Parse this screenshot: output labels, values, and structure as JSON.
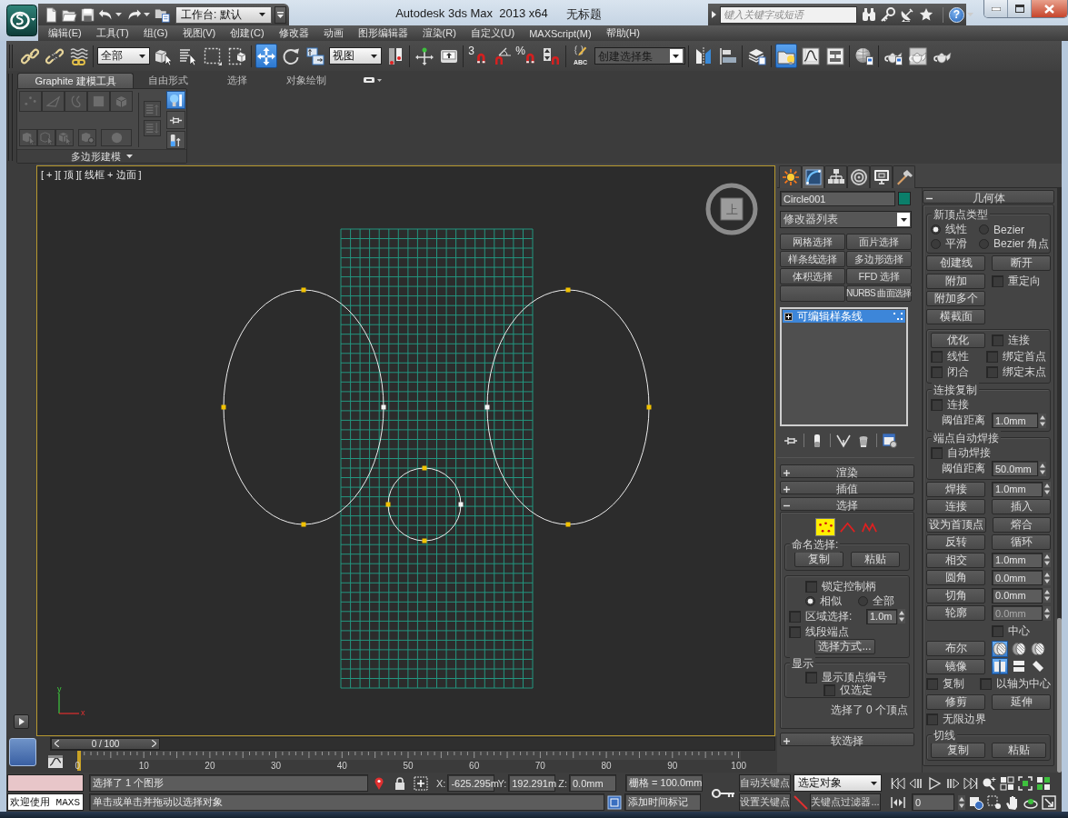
{
  "title_bar": {
    "workspace": "工作台: 默认",
    "app_title": "Autodesk 3ds Max  2013 x64",
    "document_title": "无标题",
    "search": {
      "placeholder": "键入关键字或短语"
    },
    "help": "?"
  },
  "menu_bar": [
    "编辑(E)",
    "工具(T)",
    "组(G)",
    "视图(V)",
    "创建(C)",
    "修改器",
    "动画",
    "图形编辑器",
    "渲染(R)",
    "自定义(U)",
    "MAXScript(M)",
    "帮助(H)"
  ],
  "main_toolbar": [
    {
      "kind": "tool",
      "selected": false
    },
    {
      "kind": "tool",
      "selected": false
    },
    {
      "kind": "tool",
      "selected": false
    },
    {
      "kind": "separator"
    },
    {
      "kind": "dropdown",
      "value": "全部"
    },
    {
      "kind": "tool",
      "selected": false
    },
    {
      "kind": "tool",
      "selected": false
    },
    {
      "kind": "tool",
      "selected": false
    },
    {
      "kind": "tool",
      "selected": false
    },
    {
      "kind": "separator"
    },
    {
      "kind": "tool",
      "selected": true
    },
    {
      "kind": "tool",
      "selected": false
    },
    {
      "kind": "tool",
      "selected": false
    },
    {
      "kind": "dropdown",
      "value": "视图"
    },
    {
      "kind": "tool",
      "selected": false
    },
    {
      "kind": "separator"
    },
    {
      "kind": "tool",
      "selected": false
    },
    {
      "kind": "tool",
      "selected": false
    },
    {
      "kind": "separator"
    },
    {
      "kind": "tool",
      "selected": false,
      "glyph": "3"
    },
    {
      "kind": "tool",
      "selected": false
    },
    {
      "kind": "tool",
      "selected": false,
      "glyph": "%"
    },
    {
      "kind": "tool",
      "selected": false
    },
    {
      "kind": "separator"
    },
    {
      "kind": "tool",
      "selected": false,
      "glyph": "ABC"
    },
    {
      "kind": "combo",
      "placeholder": "创建选择集"
    },
    {
      "kind": "separator"
    },
    {
      "kind": "tool",
      "selected": false
    },
    {
      "kind": "tool",
      "selected": false
    },
    {
      "kind": "separator"
    },
    {
      "kind": "tool",
      "selected": false
    },
    {
      "kind": "separator"
    },
    {
      "kind": "tool",
      "selected": true
    },
    {
      "kind": "tool",
      "selected": false
    },
    {
      "kind": "tool",
      "selected": false
    },
    {
      "kind": "separator"
    },
    {
      "kind": "tool",
      "selected": false
    },
    {
      "kind": "separator"
    },
    {
      "kind": "tool",
      "selected": false
    },
    {
      "kind": "tool",
      "selected": false
    },
    {
      "kind": "tool",
      "selected": false
    }
  ],
  "ribbon": {
    "tabs": [
      {
        "label": "Graphite 建模工具",
        "selected": true
      },
      {
        "label": "自由形式",
        "selected": false
      },
      {
        "label": "选择",
        "selected": false
      },
      {
        "label": "对象绘制",
        "selected": false
      }
    ],
    "panel": {
      "title": "多边形建模",
      "tools": [
        {
          "disabled": true,
          "selected": false
        },
        {
          "disabled": true,
          "selected": false
        },
        {
          "disabled": true,
          "selected": false
        },
        {
          "disabled": true,
          "selected": false
        },
        {
          "disabled": true,
          "selected": false
        },
        {
          "disabled": true,
          "selected": false
        },
        {
          "disabled": true,
          "selected": false
        },
        {
          "disabled": true,
          "selected": false
        },
        {
          "disabled": true,
          "selected": false
        },
        {
          "disabled": true,
          "selected": false
        },
        {
          "disabled": true,
          "selected": false
        },
        {
          "disabled": true,
          "selected": false
        },
        {
          "disabled": false,
          "selected": true
        },
        {
          "disabled": false,
          "selected": false
        },
        {
          "disabled": false,
          "selected": false
        }
      ]
    }
  },
  "viewport": {
    "label": "[ + ][ 顶 ][ 线框 + 边面 ]",
    "view_cube": {
      "face": "上"
    },
    "axis_tripod": {
      "x": "x",
      "y": "y"
    }
  },
  "time_slider": {
    "frame": "0 / 100",
    "level": 0
  },
  "track_bar": {
    "ticks": [
      "0",
      "10",
      "20",
      "30",
      "40",
      "50",
      "60",
      "70",
      "80",
      "90",
      "100"
    ]
  },
  "command_panel": {
    "tabs": [
      {
        "selected": false
      },
      {
        "selected": true
      },
      {
        "selected": false
      },
      {
        "selected": false
      },
      {
        "selected": false
      },
      {
        "selected": false
      }
    ],
    "object": {
      "name": "Circle001",
      "color": "#0b7e6a"
    },
    "modifier_list": "修改器列表",
    "modifier_buttons": [
      {
        "kind": "button",
        "label": "网格选择"
      },
      {
        "kind": "button",
        "label": "面片选择"
      },
      {
        "kind": "button",
        "label": "样条线选择"
      },
      {
        "kind": "button",
        "label": "多边形选择"
      },
      {
        "kind": "button",
        "label": "体积选择"
      },
      {
        "kind": "button",
        "label": "FFD 选择"
      },
      {
        "kind": "blank"
      },
      {
        "kind": "button",
        "label": "NURBS 曲面选择"
      }
    ],
    "stack": [
      {
        "label": "可编辑样条线",
        "selected": true
      }
    ],
    "left_rollouts": [
      {
        "title": "渲染",
        "expanded": false
      },
      {
        "title": "插值",
        "expanded": false
      },
      {
        "title": "选择",
        "expanded": true,
        "content": {
          "levels": [
            {
              "selected": true
            },
            {
              "selected": false
            },
            {
              "selected": false
            }
          ],
          "named_selection": {
            "title": "命名选择:",
            "buttons": [
              "复制",
              "粘贴"
            ]
          },
          "lock_handles": {
            "label": "锁定控制柄",
            "checked": false
          },
          "handle_mode": [
            {
              "label": "相似",
              "selected": true
            },
            {
              "label": "全部",
              "selected": false
            }
          ],
          "area_selection": {
            "label": "区域选择:",
            "checked": false,
            "value": "1.0m"
          },
          "segment_end": {
            "label": "线段端点",
            "checked": false
          },
          "select_by": "选择方式...",
          "display": {
            "title": "显示",
            "show_vertex_numbers": {
              "label": "显示顶点编号",
              "checked": false
            },
            "selected_only": {
              "label": "仅选定",
              "checked": false
            }
          },
          "status": "选择了 0 个顶点"
        }
      },
      {
        "title": "软选择",
        "expanded": false
      }
    ],
    "geometry_rollout": {
      "title": "几何体",
      "expanded": true,
      "sections": [
        {
          "kind": "group",
          "title": "新顶点类型",
          "rows": [
            [
              {
                "kind": "radio",
                "label": "线性",
                "selected": true
              },
              {
                "kind": "radio",
                "label": "Bezier",
                "selected": false
              }
            ],
            [
              {
                "kind": "radio",
                "label": "平滑",
                "selected": false
              },
              {
                "kind": "radio",
                "label": "Bezier 角点",
                "selected": false
              }
            ]
          ]
        },
        {
          "kind": "rows",
          "rows": [
            [
              {
                "kind": "button",
                "label": "创建线"
              },
              {
                "kind": "button",
                "label": "断开"
              }
            ],
            [
              {
                "kind": "button",
                "label": "附加"
              },
              {
                "kind": "checkbox",
                "label": "重定向",
                "checked": false
              }
            ],
            [
              {
                "kind": "button",
                "label": "附加多个"
              }
            ],
            [
              {
                "kind": "button",
                "label": "横截面"
              }
            ]
          ]
        },
        {
          "kind": "group",
          "rows": [
            [
              {
                "kind": "button",
                "label": "优化"
              },
              {
                "kind": "checkbox",
                "label": "连接",
                "checked": false
              }
            ],
            [
              {
                "kind": "checkbox",
                "label": "线性",
                "checked": false
              },
              {
                "kind": "checkbox",
                "label": "绑定首点",
                "checked": false
              }
            ],
            [
              {
                "kind": "checkbox",
                "label": "闭合",
                "checked": false
              },
              {
                "kind": "checkbox",
                "label": "绑定末点",
                "checked": false
              }
            ]
          ]
        },
        {
          "kind": "group",
          "title": "连接复制",
          "rows": [
            [
              {
                "kind": "checkbox",
                "label": "连接",
                "checked": false
              }
            ],
            [
              {
                "kind": "label",
                "label": "阈值距离"
              },
              {
                "kind": "spinner",
                "value": "1.0mm",
                "disabled": false
              }
            ]
          ]
        },
        {
          "kind": "group",
          "title": "端点自动焊接",
          "rows": [
            [
              {
                "kind": "checkbox",
                "label": "自动焊接",
                "checked": false
              }
            ],
            [
              {
                "kind": "label",
                "label": "阈值距离"
              },
              {
                "kind": "spinner",
                "value": "50.0mm",
                "disabled": false
              }
            ]
          ]
        },
        {
          "kind": "rows",
          "rows": [
            [
              {
                "kind": "button",
                "label": "焊接"
              },
              {
                "kind": "spinner",
                "value": "1.0mm",
                "disabled": false
              }
            ],
            [
              {
                "kind": "button",
                "label": "连接"
              },
              {
                "kind": "button",
                "label": "插入"
              }
            ],
            [
              {
                "kind": "button",
                "label": "设为首顶点"
              },
              {
                "kind": "button",
                "label": "熔合"
              }
            ],
            [
              {
                "kind": "button",
                "label": "反转"
              },
              {
                "kind": "button",
                "label": "循环"
              }
            ],
            [
              {
                "kind": "button",
                "label": "相交"
              },
              {
                "kind": "spinner",
                "value": "1.0mm",
                "disabled": false
              }
            ],
            [
              {
                "kind": "button",
                "label": "圆角"
              },
              {
                "kind": "spinner",
                "value": "0.0mm",
                "disabled": false
              }
            ],
            [
              {
                "kind": "button",
                "label": "切角"
              },
              {
                "kind": "spinner",
                "value": "0.0mm",
                "disabled": false
              }
            ],
            [
              {
                "kind": "button",
                "label": "轮廓"
              },
              {
                "kind": "spinner",
                "value": "0.0mm",
                "disabled": true
              }
            ],
            [
              {
                "kind": "spacer"
              },
              {
                "kind": "checkbox",
                "label": "中心",
                "checked": false
              }
            ],
            [
              {
                "kind": "button",
                "label": "布尔"
              },
              {
                "kind": "toggles",
                "items": [
                  {
                    "selected": true
                  },
                  {
                    "selected": false
                  },
                  {
                    "selected": false
                  }
                ]
              }
            ],
            [
              {
                "kind": "button",
                "label": "镜像"
              },
              {
                "kind": "toggles",
                "items": [
                  {
                    "selected": true
                  },
                  {
                    "selected": false
                  },
                  {
                    "selected": false
                  }
                ]
              }
            ],
            [
              {
                "kind": "checkbox",
                "label": "复制",
                "checked": false
              },
              {
                "kind": "checkbox",
                "label": "以轴为中心",
                "checked": false
              }
            ],
            [
              {
                "kind": "button",
                "label": "修剪"
              },
              {
                "kind": "button",
                "label": "延伸"
              }
            ],
            [
              {
                "kind": "checkbox",
                "label": "无限边界",
                "checked": false
              }
            ]
          ]
        },
        {
          "kind": "group",
          "title": "切线",
          "rows": [
            [
              {
                "kind": "button",
                "label": "复制"
              },
              {
                "kind": "button",
                "label": "粘贴"
              }
            ]
          ]
        }
      ]
    }
  },
  "status_bar": {
    "listener": "欢迎使用 MAXS",
    "selection_status": "选择了 1 个图形",
    "prompt": "单击或单击并拖动以选择对象",
    "coords": [
      {
        "axis": "X:",
        "value": "-625.295m"
      },
      {
        "axis": "Y:",
        "value": "192.291m"
      },
      {
        "axis": "Z:",
        "value": "0.0mm"
      }
    ],
    "grid": "栅格 = 100.0mm",
    "add_time_tag": "添加时间标记",
    "auto_key": "自动关键点",
    "set_key": "设置关键点",
    "key_mode": "选定对象",
    "key_filters": "关键点过滤器...",
    "frame": "0"
  }
}
